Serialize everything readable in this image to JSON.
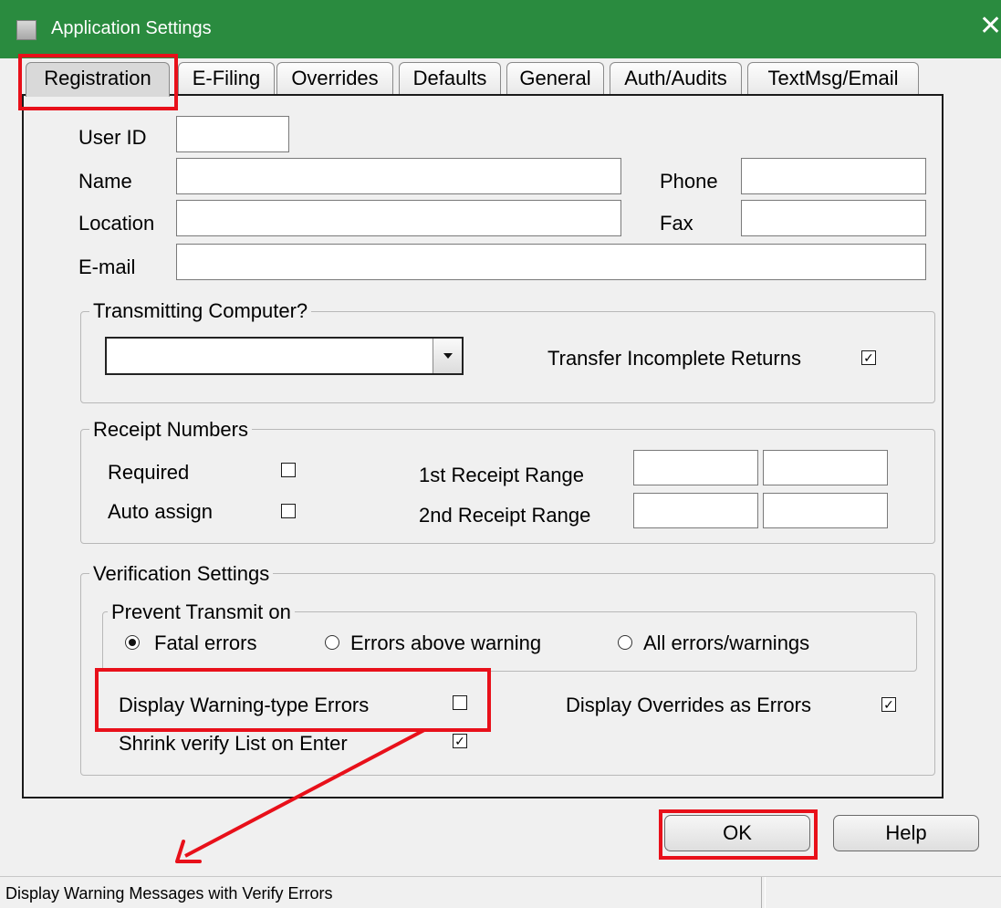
{
  "window": {
    "title": "Application Settings",
    "app_icon": "application-icon",
    "close_symbol": "✕"
  },
  "tabs": [
    {
      "label": "Registration",
      "active": true
    },
    {
      "label": "E-Filing"
    },
    {
      "label": "Overrides"
    },
    {
      "label": "Defaults"
    },
    {
      "label": "General"
    },
    {
      "label": "Auth/Audits"
    },
    {
      "label": "TextMsg/Email"
    }
  ],
  "registration": {
    "user_id": {
      "label": "User ID",
      "value": ""
    },
    "name": {
      "label": "Name",
      "value": ""
    },
    "phone": {
      "label": "Phone",
      "value": ""
    },
    "location": {
      "label": "Location",
      "value": ""
    },
    "fax": {
      "label": "Fax",
      "value": ""
    },
    "email": {
      "label": "E-mail",
      "value": ""
    }
  },
  "transmitting": {
    "legend": "Transmitting Computer?",
    "selected": "",
    "transfer_incomplete": {
      "label": "Transfer Incomplete Returns",
      "checked": true
    }
  },
  "receipts": {
    "legend": "Receipt Numbers",
    "required": {
      "label": "Required",
      "checked": false
    },
    "auto_assign": {
      "label": "Auto assign",
      "checked": false
    },
    "range1": {
      "label": "1st Receipt Range",
      "from": "",
      "to": ""
    },
    "range2": {
      "label": "2nd Receipt Range",
      "from": "",
      "to": ""
    }
  },
  "verification": {
    "legend": "Verification Settings",
    "prevent_legend": "Prevent Transmit on",
    "options": [
      {
        "label": "Fatal errors",
        "selected": true
      },
      {
        "label": "Errors above warning",
        "selected": false
      },
      {
        "label": "All errors/warnings",
        "selected": false
      }
    ],
    "display_warning": {
      "label": "Display Warning-type Errors",
      "checked": false
    },
    "display_overrides": {
      "label": "Display Overrides as Errors",
      "checked": true
    },
    "shrink_verify": {
      "label": "Shrink verify List on Enter",
      "checked": true
    }
  },
  "buttons": {
    "ok": "OK",
    "help": "Help"
  },
  "status": {
    "text": "Display Warning Messages with Verify Errors"
  },
  "check_mark": "✓",
  "colors": {
    "titlebar": "#2a8b3f",
    "highlight": "#e8101a"
  }
}
